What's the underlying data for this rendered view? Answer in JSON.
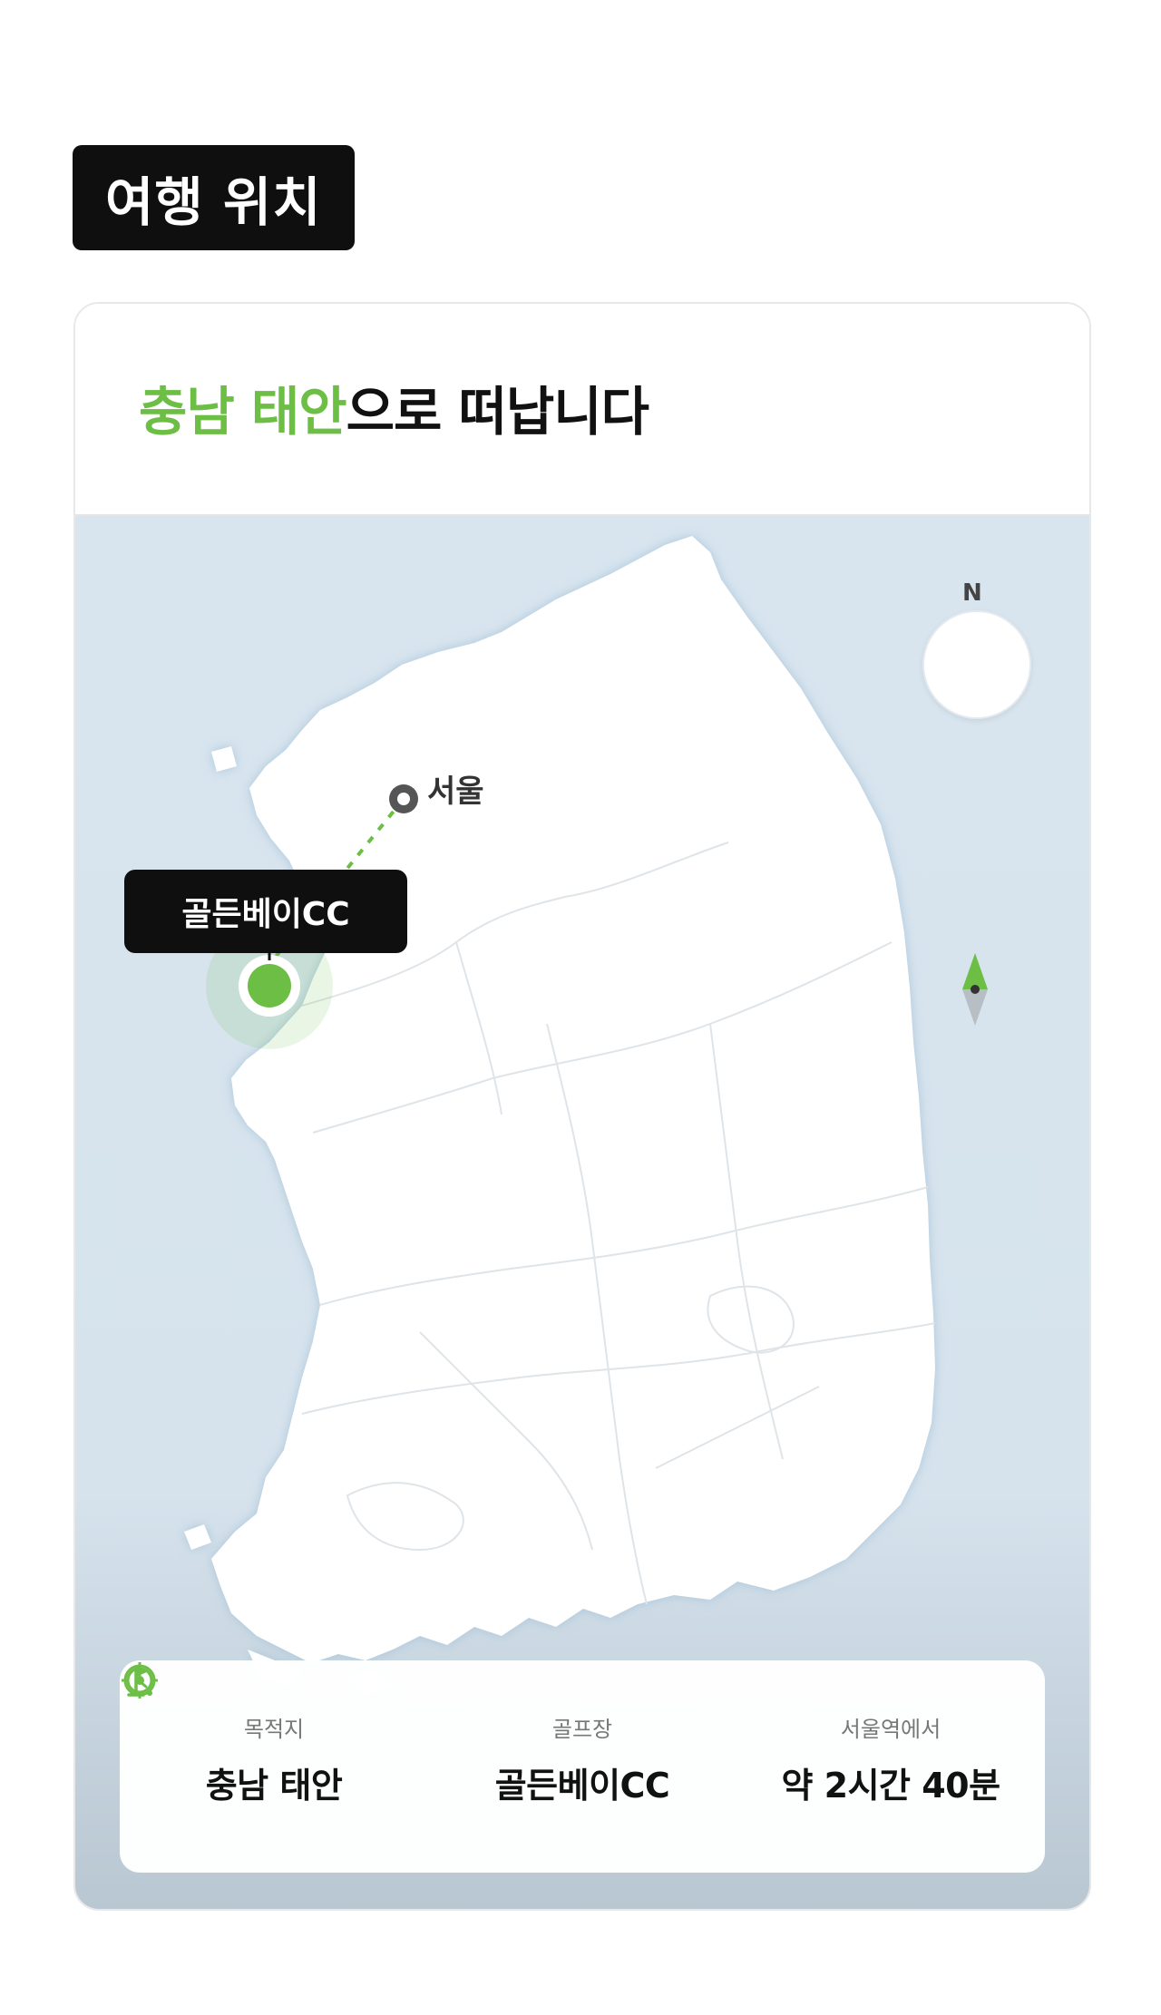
{
  "section_title": "여행 위치",
  "headline": {
    "highlight": "충남 태안",
    "rest": "으로 떠납니다"
  },
  "map": {
    "compass_label": "N",
    "origin_city": "서울",
    "destination_label": "골든베이CC",
    "accent_color": "#6cbe45",
    "route_style": "dashed"
  },
  "info": [
    {
      "icon": "target-icon",
      "label": "목적지",
      "value": "충남 태안"
    },
    {
      "icon": "golf-flag-icon",
      "label": "골프장",
      "value": "골든베이CC"
    },
    {
      "icon": "clock-icon",
      "label": "서울역에서",
      "value": "약 2시간 40분"
    }
  ]
}
